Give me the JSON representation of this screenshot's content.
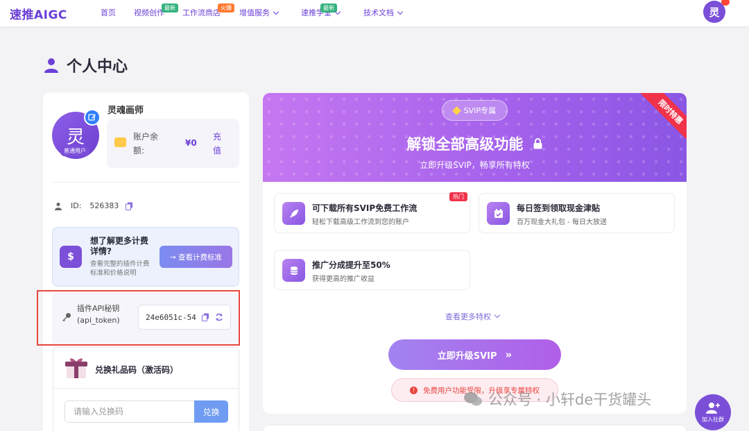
{
  "header": {
    "logo": "速推AIGC",
    "nav": [
      {
        "label": "首页"
      },
      {
        "label": "视频创作",
        "badge": "最新"
      },
      {
        "label": "工作流商店",
        "badge": "火爆"
      },
      {
        "label": "增值服务"
      },
      {
        "label": "速推学堂",
        "badge": "最新"
      },
      {
        "label": "技术文档"
      }
    ],
    "avatar_char": "灵"
  },
  "page": {
    "title": "个人中心"
  },
  "profile": {
    "avatar_char": "灵",
    "role": "普通用户",
    "username": "灵魂画师",
    "balance_label": "账户余额:",
    "balance_value": "¥0",
    "recharge_label": "充值",
    "id_label": "ID:",
    "id_value": "526383"
  },
  "fee": {
    "title": "想了解更多计费详情?",
    "subtitle": "查看完整的插件计费标准和价格说明",
    "button": "→ 查看计费标准"
  },
  "api": {
    "label": "插件API秘钥(api_token)",
    "value": "24e6051c-54"
  },
  "gift": {
    "title": "兑换礼品码（激活码）",
    "placeholder": "请输入兑换码",
    "button": "兑换"
  },
  "svip": {
    "pill": "SVIP专属",
    "ribbon": "限时特惠",
    "headline": "解锁全部高级功能",
    "subheadline": "立即升级SVIP，畅享所有特权",
    "features": [
      {
        "title": "可下载所有SVIP免费工作流",
        "desc": "轻松下载高级工作流到您的账户",
        "tag": "热门"
      },
      {
        "title": "每日签到领取现金津贴",
        "desc": "百万现金大礼包 - 每日大放送"
      },
      {
        "title": "推广分成提升至50%",
        "desc": "获得更高的推广收益"
      }
    ],
    "more": "查看更多特权",
    "upgrade_button": "立即升级SVIP",
    "notice": "免费用户功能受限，升级享专属特权"
  },
  "watermark": "公众号 · 小轩de干货罐头",
  "join_label": "加入社群"
}
